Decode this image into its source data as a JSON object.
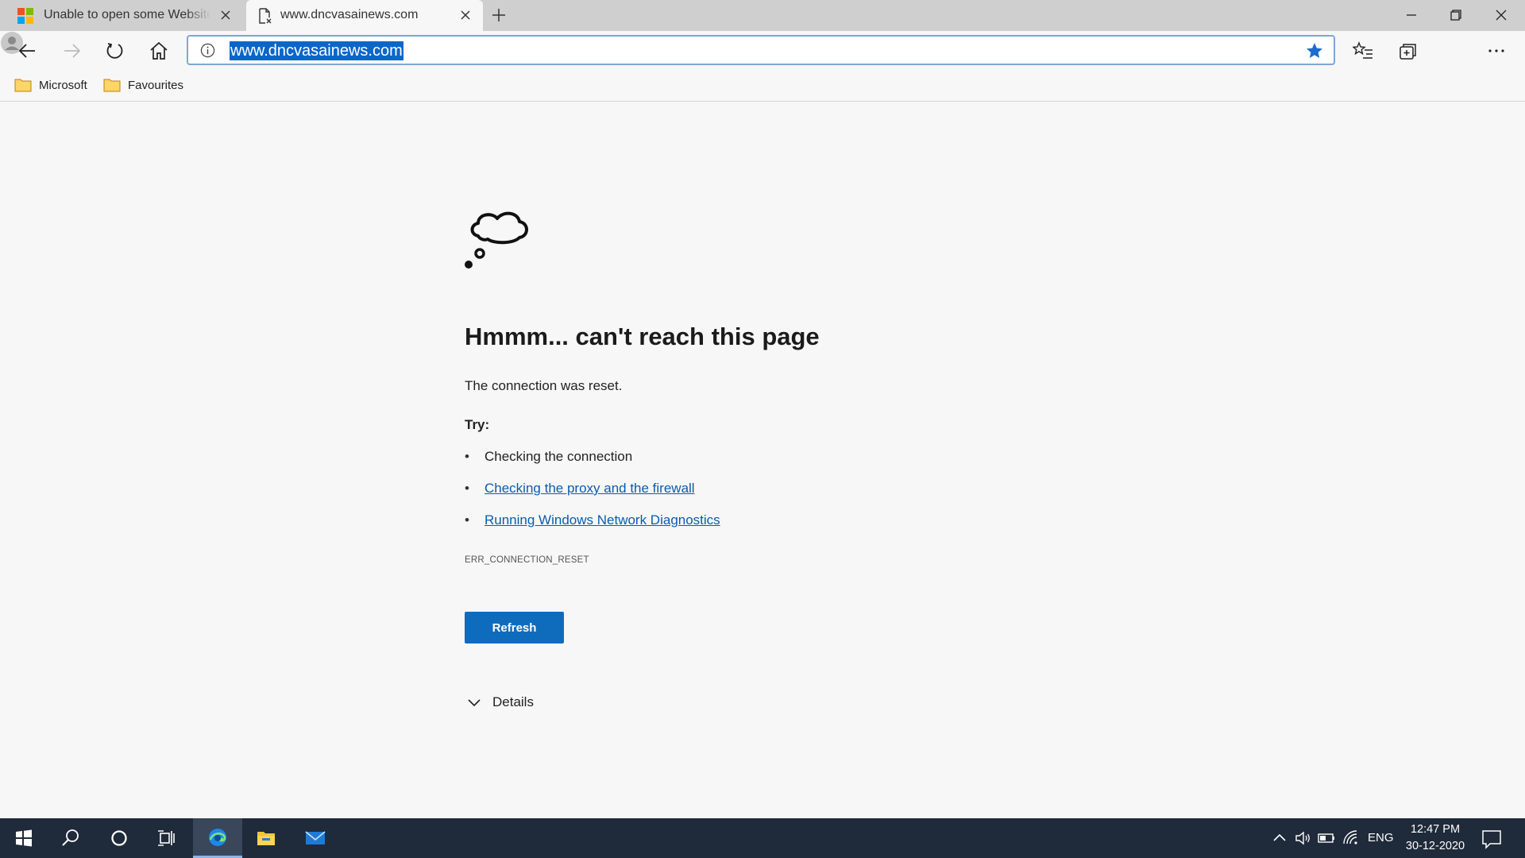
{
  "tabs": [
    {
      "title": "Unable to open some Websites in Microsoft Edge",
      "icon": "microsoft-logo-icon",
      "active": false
    },
    {
      "title": "www.dncvasainews.com",
      "icon": "broken-page-icon",
      "active": true
    }
  ],
  "address_bar": {
    "url": "www.dncvasainews.com"
  },
  "favorites_bar": {
    "items": [
      {
        "label": "Microsoft",
        "icon": "folder-icon"
      },
      {
        "label": "Favourites",
        "icon": "folder-icon"
      }
    ]
  },
  "error_page": {
    "title": "Hmmm... can't reach this page",
    "description": "The connection was reset.",
    "try_label": "Try:",
    "suggestions": [
      {
        "text": "Checking the connection",
        "link": false
      },
      {
        "text": "Checking the proxy and the firewall",
        "link": true
      },
      {
        "text": "Running Windows Network Diagnostics",
        "link": true
      }
    ],
    "error_code": "ERR_CONNECTION_RESET",
    "refresh_label": "Refresh",
    "details_label": "Details"
  },
  "taskbar": {
    "language": "ENG",
    "time": "12:47 PM",
    "date": "30-12-2020"
  },
  "colors": {
    "accent": "#0f6cbd",
    "link": "#0b5cad",
    "url_selection": "#0a66c9",
    "taskbar": "#1f2a3a"
  }
}
